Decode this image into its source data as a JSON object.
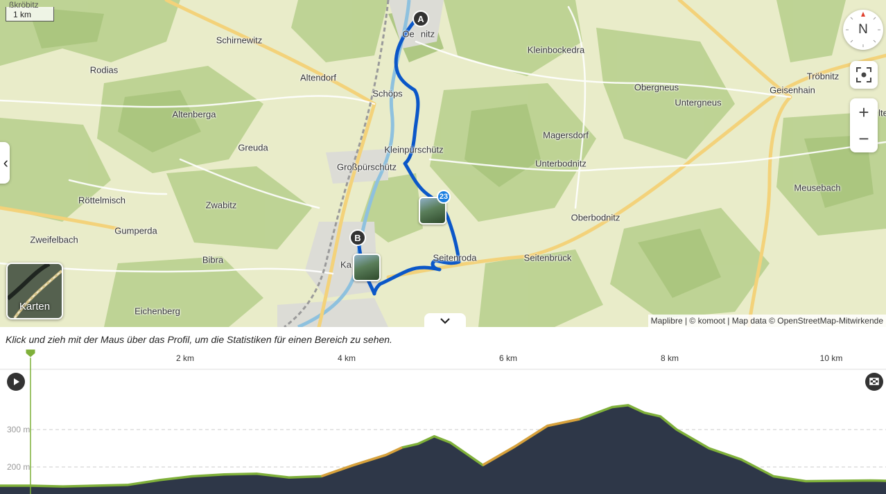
{
  "map": {
    "scale_label": "1 km",
    "scale_place_partial": "ßkröbitz",
    "compass_label": "N",
    "zoom_in_label": "+",
    "zoom_out_label": "−",
    "side_tab_icon": "chevron-left-icon",
    "side_tab_glyph": "‹",
    "maps_button_label": "Karten",
    "attribution": "Maplibre | © komoot | Map data © OpenStreetMap-Mitwirkende",
    "collapse_glyph": "⌄",
    "start_marker": "A",
    "end_marker": "B",
    "waypoint_badge": "23",
    "partial_label_right": "lte",
    "places": {
      "schirnewitz": "Schirnewitz",
      "rodias": "Rodias",
      "altendorf": "Altendorf",
      "altenberga": "Altenberga",
      "schoeps": "Schöps",
      "kleinbockedra": "Kleinbockedra",
      "obergneus": "Obergneus",
      "untergneus": "Untergneus",
      "geisenhain": "Geisenhain",
      "troebnitz": "Tröbnitz",
      "magersdorf": "Magersdorf",
      "greuda": "Greuda",
      "kleinpuerschuetz": "Kleinpürschütz",
      "grosspuerschuetz": "Großpürschütz",
      "unterbodnitz": "Unterbodnitz",
      "meusebach": "Meusebach",
      "roettelmisch": "Röttelmisch",
      "zwabitz": "Zwabitz",
      "oberbodnitz": "Oberbodnitz",
      "gumperda": "Gumperda",
      "zweifelbach": "Zweifelbach",
      "bibra": "Bibra",
      "seitenroda": "Seitenroda",
      "seitenbrueck": "Seitenbrück",
      "eichenberg": "Eichenberg",
      "ka_partial": "Ka",
      "oe_partial": "Oe",
      "nitz_partial": "nitz"
    },
    "colors": {
      "route": "#0b57c8",
      "forest": "#b9d08e",
      "meadow": "#e9ecc9",
      "road": "#f6d77a",
      "water": "#8ec1de"
    }
  },
  "profile": {
    "hint": "Klick und zieh mit der Maus über das Profil, um die Statistiken für einen Bereich zu sehen.",
    "play_icon": "play-icon",
    "finish_icon": "finish-flag-icon"
  },
  "chart_data": {
    "type": "area",
    "x_unit": "km",
    "x_ticks": [
      "2 km",
      "4 km",
      "6 km",
      "8 km",
      "10 km"
    ],
    "y_ticks": [
      "300 m",
      "200 m"
    ],
    "xlim": [
      0,
      11.0
    ],
    "x": [
      0,
      0.4,
      0.8,
      1.2,
      1.6,
      2.0,
      2.4,
      2.8,
      3.2,
      3.6,
      4.0,
      4.4,
      4.6,
      4.8,
      5.0,
      5.2,
      5.6,
      6.0,
      6.4,
      6.8,
      7.2,
      7.4,
      7.6,
      7.8,
      8.0,
      8.4,
      8.8,
      9.2,
      9.6,
      10.0,
      10.4,
      10.8,
      11.0
    ],
    "elevation_m": [
      150,
      148,
      150,
      152,
      165,
      175,
      180,
      182,
      172,
      175,
      205,
      232,
      252,
      262,
      282,
      265,
      205,
      255,
      310,
      328,
      360,
      365,
      345,
      335,
      300,
      250,
      220,
      175,
      162,
      163,
      164,
      162,
      161
    ],
    "colors": {
      "fill": "#2e3748",
      "line": "#7fb03a",
      "steep": "#d8a03c"
    }
  }
}
